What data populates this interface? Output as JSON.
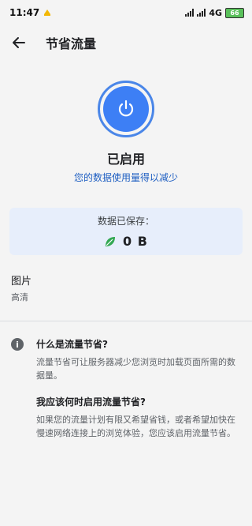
{
  "status_bar": {
    "time": "11:47",
    "network": "4G",
    "battery": "66"
  },
  "toolbar": {
    "title": "节省流量"
  },
  "hero": {
    "status": "已启用",
    "subtitle": "您的数据使用量得以减少",
    "accent_color": "#3d7ff5"
  },
  "saved": {
    "label": "数据已保存：",
    "value": "0 B"
  },
  "image_setting": {
    "title": "图片",
    "value": "高清"
  },
  "faq": [
    {
      "question": "什么是流量节省?",
      "answer": "流量节省可让服务器减少您浏览时加载页面所需的数据量。"
    },
    {
      "question": "我应该何时启用流量节省?",
      "answer": "如果您的流量计划有限又希望省钱，或者希望加快在慢速网络连接上的浏览体验，您应该启用流量节省。"
    }
  ]
}
